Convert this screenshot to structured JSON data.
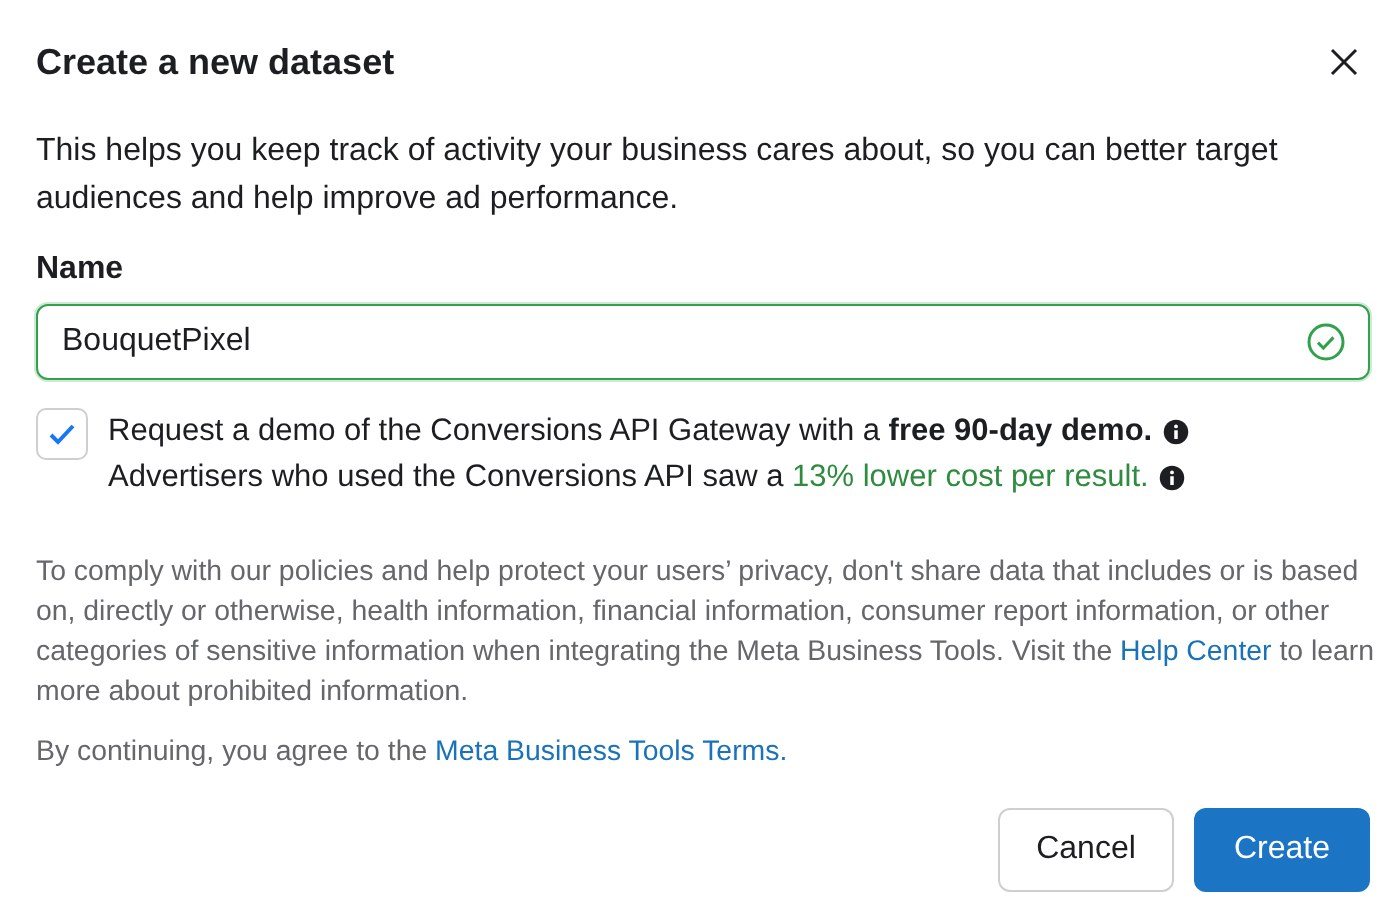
{
  "dialog": {
    "title": "Create a new dataset",
    "description": "This helps you keep track of activity your business cares about, so you can better target audiences and help improve ad performance.",
    "name_field": {
      "label": "Name",
      "value": "BouquetPixel",
      "valid": true
    },
    "demo_option": {
      "checked": true,
      "line_1": "Request a demo of the Conversions API Gateway with a **free 90-day demo.**",
      "line_2": "Advertisers who used the Conversions API saw a ",
      "line_2_highlight": "13% lower cost per result."
    },
    "privacy_notice": {
      "text": "To comply with our policies and help protect your users’ privacy, don't share data that includes or is based on, directly or otherwise, health information, financial information, consumer report information, or other categories of sensitive information when integrating the Meta Business Tools. Visit the ",
      "link": "Help Center",
      "text_after": " to learn more about prohibited information."
    },
    "terms": {
      "text": "By continuing, you agree to the ",
      "link": "Meta Business Tools Terms."
    },
    "buttons": [
      {
        "label": "Cancel",
        "kind": "secondary"
      },
      {
        "label": "Create",
        "kind": "primary"
      }
    ]
  }
}
